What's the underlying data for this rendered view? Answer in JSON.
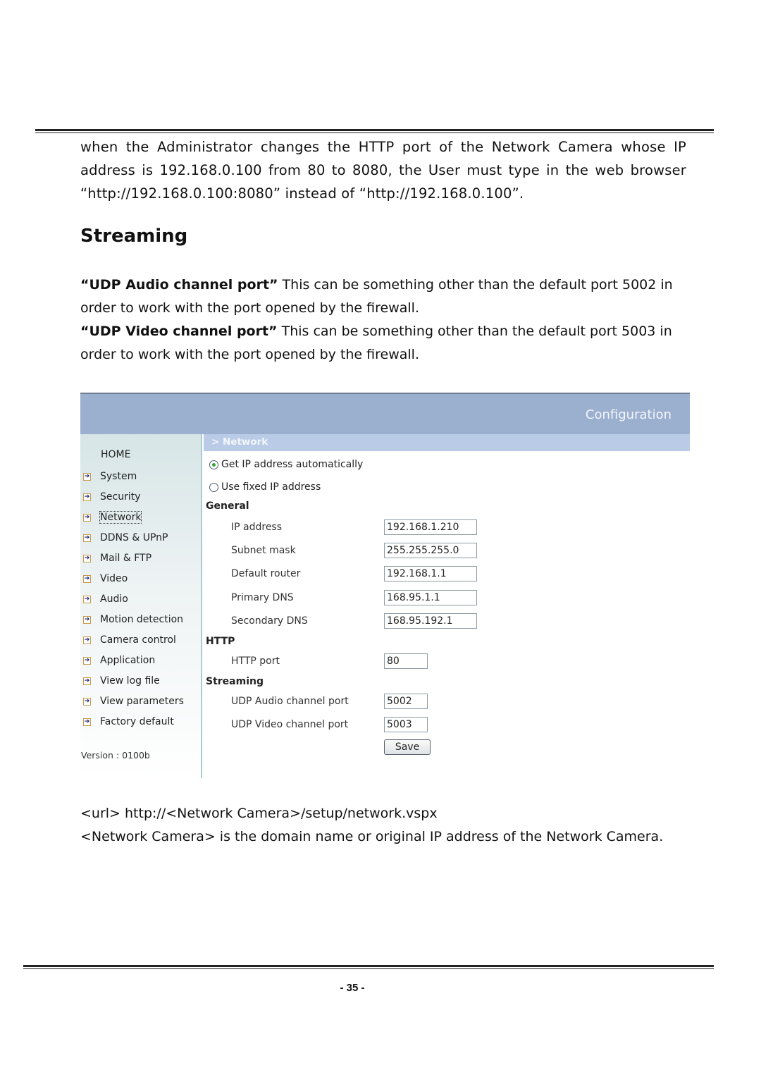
{
  "intro": {
    "line1": "when the Administrator changes the HTTP port of the Network Camera whose IP",
    "line2": "address is 192.168.0.100 from 80 to 8080, the User must type in the web browser",
    "line3": "“http://192.168.0.100:8080” instead of “http://192.168.0.100”."
  },
  "heading": "Streaming",
  "descriptions": [
    {
      "term": "“UDP Audio channel port”",
      "text": " This can be something other than the default port 5002 in order to work with the port opened by the firewall."
    },
    {
      "term": "“UDP Video channel port”",
      "text": " This can be something other than the default port 5003 in order to work with the port opened by the firewall."
    }
  ],
  "screenshot": {
    "header_title": "Configuration",
    "breadcrumb": "> Network",
    "sidebar": {
      "home": "HOME",
      "items": [
        "System",
        "Security",
        "Network",
        "DDNS & UPnP",
        "Mail & FTP",
        "Video",
        "Audio",
        "Motion detection",
        "Camera control",
        "Application",
        "View log file",
        "View parameters",
        "Factory default"
      ],
      "active": "Network",
      "version": "Version : 0100b"
    },
    "ip_mode": {
      "auto_label": "Get IP address automatically",
      "fixed_label": "Use fixed IP address",
      "selected": "auto"
    },
    "general": {
      "title": "General",
      "fields": [
        {
          "label": "IP address",
          "value": "192.168.1.210"
        },
        {
          "label": "Subnet mask",
          "value": "255.255.255.0"
        },
        {
          "label": "Default router",
          "value": "192.168.1.1"
        },
        {
          "label": "Primary DNS",
          "value": "168.95.1.1"
        },
        {
          "label": "Secondary DNS",
          "value": "168.95.192.1"
        }
      ]
    },
    "http": {
      "title": "HTTP",
      "fields": [
        {
          "label": "HTTP port",
          "value": "80"
        }
      ]
    },
    "streaming": {
      "title": "Streaming",
      "fields": [
        {
          "label": "UDP Audio channel port",
          "value": "5002"
        },
        {
          "label": "UDP Video channel port",
          "value": "5003"
        }
      ]
    },
    "save_label": "Save"
  },
  "url": {
    "line1": "<url> http://<Network Camera>/setup/network.vspx",
    "line2": "<Network Camera> is the domain name or original IP address of the Network Camera."
  },
  "page_number": "- 35 -"
}
